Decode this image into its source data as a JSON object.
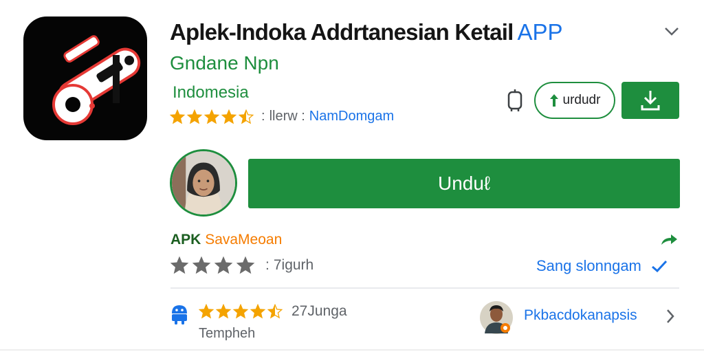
{
  "app": {
    "title": "Aplek-Indoka Addrtanesian Ketail",
    "title_accent": "APP",
    "developer": "Gndane Npn",
    "country": "Indomesia",
    "rating_separator": ":",
    "rating_text": "llerw :",
    "rating_link": "NamDomgam",
    "rating_value": 4.5
  },
  "actions": {
    "pill_button_label": "urdudr",
    "main_button_label": "Unduℓ"
  },
  "apk": {
    "label_prefix": "APK",
    "label_suffix": "SavaMeoan"
  },
  "rating_row": {
    "separator": ":",
    "count_text": "7igurh",
    "stars": 4,
    "verified_text": "Sang slonngam"
  },
  "review": {
    "stars": 4.5,
    "count_text": "27Junga",
    "category": "Tempheh",
    "reviewer_name": "Pkbacdokanapsis"
  },
  "icons": {
    "app_icon": "app-logo-icon",
    "collapse": "chevron-down-icon",
    "device": "device-icon",
    "upload_arrow": "arrow-up-icon",
    "download": "download-icon",
    "share": "share-arrow-icon",
    "verified": "check-icon",
    "robot": "android-robot-icon",
    "chevron_right": "chevron-right-icon"
  },
  "colors": {
    "brand_green": "#1e8e3e",
    "link_blue": "#1a73e8",
    "star_orange": "#f4a300",
    "star_gray": "#6b6b6b",
    "accent_orange": "#f57c00"
  }
}
